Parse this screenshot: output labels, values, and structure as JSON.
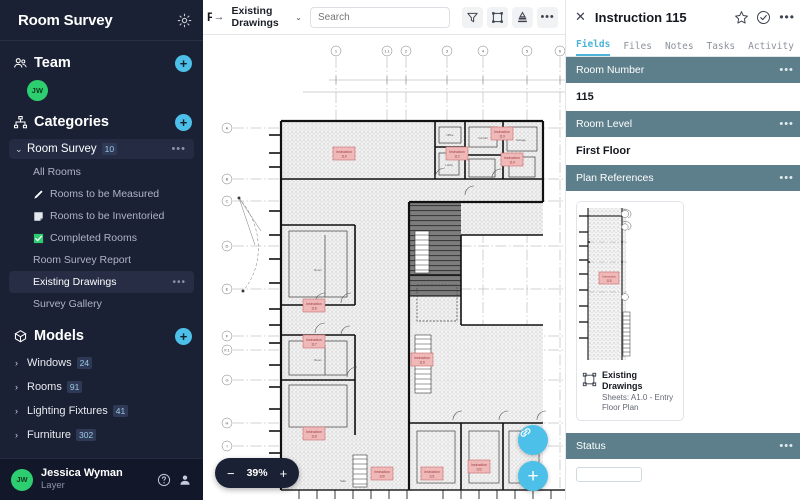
{
  "sidebar": {
    "back_icon": "arrow-left-icon",
    "title": "Room Survey",
    "settings_icon": "gear-icon",
    "team": {
      "icon": "people-icon",
      "title": "Team",
      "add_label": "+",
      "members": [
        {
          "initials": "JW"
        }
      ]
    },
    "categories": {
      "icon": "sitemap-icon",
      "title": "Categories",
      "add_label": "+",
      "group": {
        "label": "Room Survey",
        "badge": "10",
        "chevron": "⌄",
        "more": "•••"
      },
      "items": [
        {
          "label": "All Rooms",
          "icon": "none",
          "selected": false,
          "more": ""
        },
        {
          "label": "Rooms to be Measured",
          "icon": "pencil-icon",
          "selected": false,
          "more": ""
        },
        {
          "label": "Rooms to be Inventoried",
          "icon": "note-icon",
          "selected": false,
          "more": ""
        },
        {
          "label": "Completed Rooms",
          "icon": "checkbox-green-icon",
          "selected": false,
          "more": ""
        },
        {
          "label": "Room Survey Report",
          "icon": "none",
          "selected": false,
          "more": ""
        },
        {
          "label": "Existing Drawings",
          "icon": "none",
          "selected": true,
          "more": "•••"
        },
        {
          "label": "Survey Gallery",
          "icon": "none",
          "selected": false,
          "more": ""
        }
      ]
    },
    "models": {
      "icon": "model-icon",
      "title": "Models",
      "add_label": "+",
      "items": [
        {
          "label": "Windows",
          "badge": "24",
          "chevron": "›"
        },
        {
          "label": "Rooms",
          "badge": "91",
          "chevron": "›"
        },
        {
          "label": "Lighting Fixtures",
          "badge": "41",
          "chevron": "›"
        },
        {
          "label": "Furniture",
          "badge": "302",
          "chevron": "›"
        }
      ]
    },
    "footer": {
      "initials": "JW",
      "name": "Jessica Wyman",
      "org": "Layer",
      "help_icon": "help-circle-icon",
      "account_icon": "person-icon"
    }
  },
  "toolbar": {
    "crumb_first": "F",
    "crumb_arrow": "→",
    "crumb_current": "Existing Drawings",
    "crumb_chevron": "⌄",
    "search_placeholder": "Search",
    "search_value": "",
    "buttons": [
      {
        "name": "filter-icon"
      },
      {
        "name": "crop-icon"
      },
      {
        "name": "stamp-icon"
      }
    ],
    "more": "•••"
  },
  "canvas": {
    "zoom_level": "39%",
    "zoom_out": "−",
    "zoom_in": "+",
    "fab_link_icon": "link-icon",
    "fab_add_label": "+",
    "grid_columns": [
      "1",
      "1.1",
      "2",
      "3",
      "4",
      "5",
      "6"
    ],
    "grid_rows": [
      "A",
      "B",
      "C",
      "D",
      "E",
      "F",
      "F.1",
      "G",
      "H",
      "I"
    ],
    "tag_label": "115"
  },
  "panel": {
    "close_icon": "close-icon",
    "title": "Instruction 115",
    "star_icon": "star-icon",
    "check_icon": "check-circle-icon",
    "more": "•••",
    "tabs": [
      {
        "label": "Fields",
        "active": true
      },
      {
        "label": "Files",
        "active": false
      },
      {
        "label": "Notes",
        "active": false
      },
      {
        "label": "Tasks",
        "active": false
      },
      {
        "label": "Activity",
        "active": false
      }
    ],
    "fields": [
      {
        "header": "Room Number",
        "value": "115",
        "more": "•••"
      },
      {
        "header": "Room Level",
        "value": "First Floor",
        "more": "•••"
      }
    ],
    "plan_references": {
      "header": "Plan References",
      "more": "•••",
      "card": {
        "icon": "drawing-icon",
        "title": "Existing Drawings",
        "subtitle": "Sheets: A1.0 - Entry Floor Plan",
        "tag_label": "115"
      }
    },
    "status": {
      "header": "Status",
      "more": "•••"
    }
  },
  "colors": {
    "sidebar_bg": "#1b2134",
    "accent_cyan": "#4cc0e8",
    "avatar_green": "#2dce6f",
    "field_header": "#5d7f8c",
    "tag_red": "#e8a0a0"
  }
}
